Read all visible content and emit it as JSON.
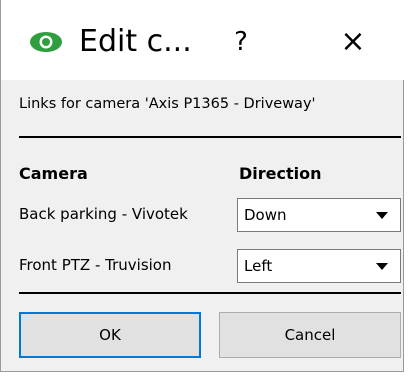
{
  "window": {
    "title": "Edit c...",
    "help_label": "?",
    "close_label": "×",
    "icon": "eye-icon"
  },
  "subtitle": "Links for camera 'Axis P1365 - Driveway'",
  "table": {
    "headers": {
      "camera": "Camera",
      "direction": "Direction"
    },
    "rows": [
      {
        "camera": "Back parking - Vivotek",
        "direction": "Down"
      },
      {
        "camera": "Front PTZ - Truvision",
        "direction": "Left"
      }
    ]
  },
  "buttons": {
    "ok": "OK",
    "cancel": "Cancel"
  },
  "colors": {
    "focus_border": "#0078d7",
    "icon_green": "#2e9e3e"
  }
}
